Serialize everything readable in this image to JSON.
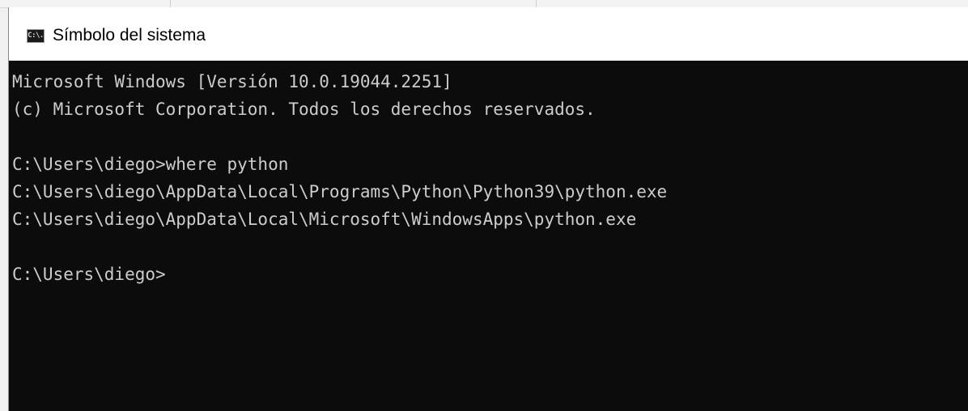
{
  "window": {
    "title": "Símbolo del sistema",
    "icon": "cmd-icon",
    "icon_glyph": "C:\\."
  },
  "console": {
    "lines": [
      "Microsoft Windows [Versión 10.0.19044.2251]",
      "(c) Microsoft Corporation. Todos los derechos reservados.",
      "",
      "C:\\Users\\diego>where python",
      "C:\\Users\\diego\\AppData\\Local\\Programs\\Python\\Python39\\python.exe",
      "C:\\Users\\diego\\AppData\\Local\\Microsoft\\WindowsApps\\python.exe",
      "",
      "C:\\Users\\diego>"
    ],
    "text_color": "#cccccc",
    "background_color": "#0c0c0c"
  }
}
